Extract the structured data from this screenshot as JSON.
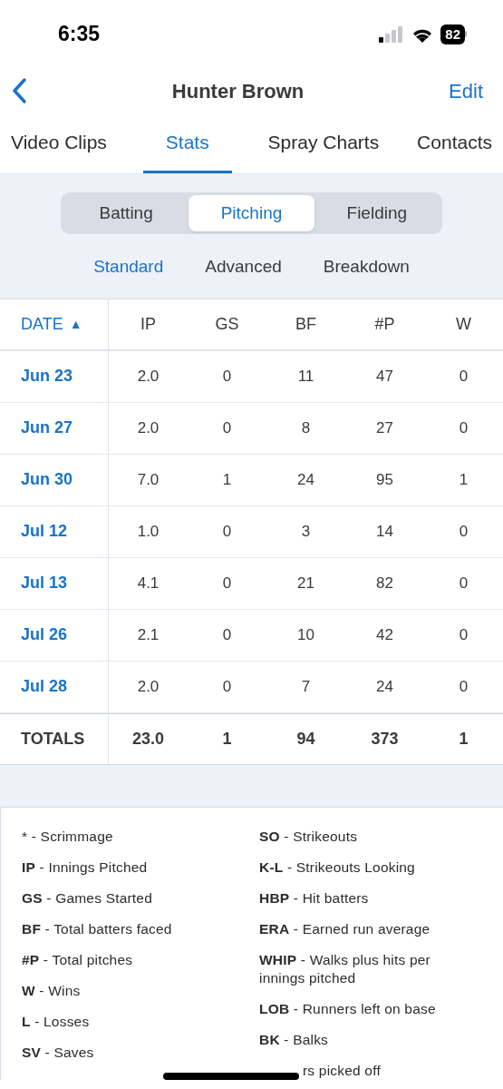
{
  "status_bar": {
    "time": "6:35",
    "battery": "82"
  },
  "nav": {
    "title": "Hunter Brown",
    "action": "Edit"
  },
  "tabs": [
    {
      "label": "Video Clips",
      "selected": false
    },
    {
      "label": "Stats",
      "selected": true
    },
    {
      "label": "Spray Charts",
      "selected": false
    },
    {
      "label": "Contacts",
      "selected": false
    }
  ],
  "segments": [
    {
      "label": "Batting",
      "selected": false
    },
    {
      "label": "Pitching",
      "selected": true
    },
    {
      "label": "Fielding",
      "selected": false
    }
  ],
  "views": [
    {
      "label": "Standard",
      "selected": true
    },
    {
      "label": "Advanced",
      "selected": false
    },
    {
      "label": "Breakdown",
      "selected": false
    }
  ],
  "table": {
    "columns": [
      {
        "label": "DATE",
        "sort": "▲"
      },
      {
        "label": "IP"
      },
      {
        "label": "GS"
      },
      {
        "label": "BF"
      },
      {
        "label": "#P"
      },
      {
        "label": "W"
      }
    ],
    "rows": [
      [
        "Jun 23",
        "2.0",
        "0",
        "11",
        "47",
        "0"
      ],
      [
        "Jun 27",
        "2.0",
        "0",
        "8",
        "27",
        "0"
      ],
      [
        "Jun 30",
        "7.0",
        "1",
        "24",
        "95",
        "1"
      ],
      [
        "Jul 12",
        "1.0",
        "0",
        "3",
        "14",
        "0"
      ],
      [
        "Jul 13",
        "4.1",
        "0",
        "21",
        "82",
        "0"
      ],
      [
        "Jul 26",
        "2.1",
        "0",
        "10",
        "42",
        "0"
      ],
      [
        "Jul 28",
        "2.0",
        "0",
        "7",
        "24",
        "0"
      ]
    ],
    "totals": [
      "TOTALS",
      "23.0",
      "1",
      "94",
      "373",
      "1"
    ]
  },
  "legend": {
    "left": [
      "* - Scrimmage",
      "**IP** - Innings Pitched",
      "**GS** - Games Started",
      "**BF** - Total batters faced",
      "**#P** - Total pitches",
      "**W** - Wins",
      "**L** - Losses",
      "**SV** - Saves"
    ],
    "right": [
      "**SO** - Strikeouts",
      "**K-L** - Strikeouts Looking",
      "**HBP** - Hit batters",
      "**ERA** - Earned run average",
      "**WHIP** - Walks plus hits per innings pitched",
      "**LOB** - Runners left on base",
      "**BK** - Balks"
    ],
    "partly_hidden": "rs picked off"
  }
}
